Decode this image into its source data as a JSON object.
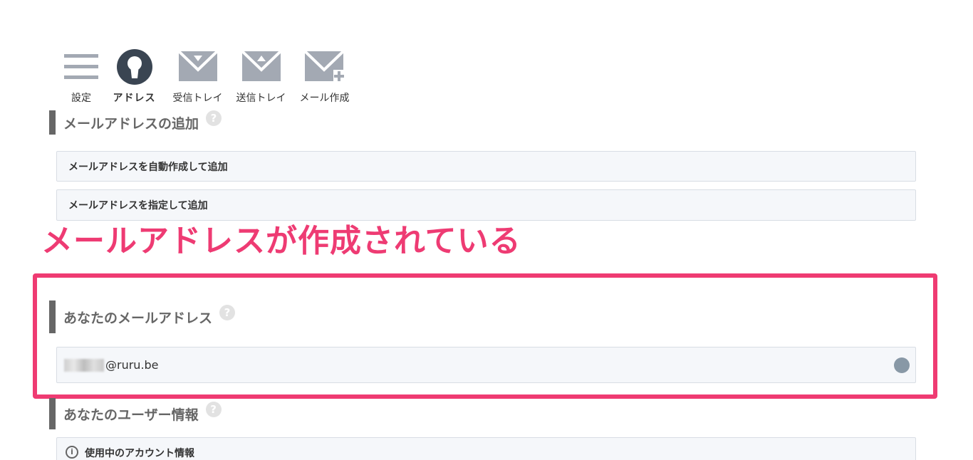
{
  "nav": {
    "items": [
      {
        "label": "設定",
        "icon": "hamburger-menu-icon"
      },
      {
        "label": "アドレス",
        "icon": "keyhole-icon",
        "active": true
      },
      {
        "label": "受信トレイ",
        "icon": "inbox-envelope-icon"
      },
      {
        "label": "送信トレイ",
        "icon": "outbox-envelope-icon"
      },
      {
        "label": "メール作成",
        "icon": "compose-envelope-icon"
      }
    ]
  },
  "add_section": {
    "title": "メールアドレスの追加",
    "help": "?",
    "options": [
      "メールアドレスを自動作成して追加",
      "メールアドレスを指定して追加"
    ]
  },
  "callout": {
    "text": "メールアドレスが作成されている",
    "color": "#ee3b73"
  },
  "your_address_section": {
    "title": "あなたのメールアドレス",
    "help": "?",
    "email_domain": "@ruru.be"
  },
  "user_info_section": {
    "title": "あなたのユーザー情報",
    "help": "?",
    "account_info_label": "使用中のアカウント情報",
    "info_icon": "i"
  },
  "colors": {
    "icon_gray": "#a3a9b3",
    "icon_dark": "#3a4552",
    "highlight": "#ef3b72"
  }
}
